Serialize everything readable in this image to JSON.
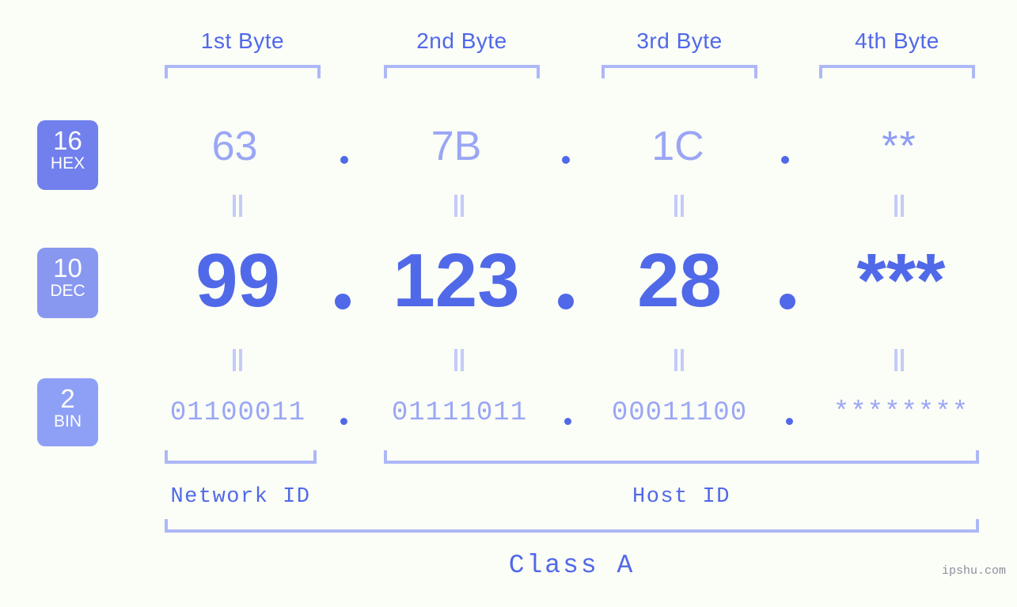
{
  "colors": {
    "background": "#fbfdf7",
    "accent": "#5069e8",
    "light_accent": "#9aa6f5",
    "bracket": "#adb8f7",
    "badge_hex": "#7180ec",
    "badge_dec": "#8897f0",
    "badge_bin": "#8ea0f6",
    "watermark": "#8a8f9e"
  },
  "byte_headers": [
    {
      "label": "1st Byte"
    },
    {
      "label": "2nd Byte"
    },
    {
      "label": "3rd Byte"
    },
    {
      "label": "4th Byte"
    }
  ],
  "bases": [
    {
      "number": "16",
      "name": "HEX"
    },
    {
      "number": "10",
      "name": "DEC"
    },
    {
      "number": "2",
      "name": "BIN"
    }
  ],
  "rows": {
    "hex": {
      "values": [
        "63",
        "7B",
        "1C",
        "**"
      ]
    },
    "dec": {
      "values": [
        "99",
        "123",
        "28",
        "***"
      ]
    },
    "bin": {
      "values": [
        "01100011",
        "01111011",
        "00011100",
        "********"
      ]
    }
  },
  "separators": {
    "dot": ".",
    "equals": "="
  },
  "segments": [
    {
      "label": "Network ID"
    },
    {
      "label": "Host ID"
    }
  ],
  "class": {
    "label": "Class A"
  },
  "watermark": {
    "text": "ipshu.com"
  }
}
